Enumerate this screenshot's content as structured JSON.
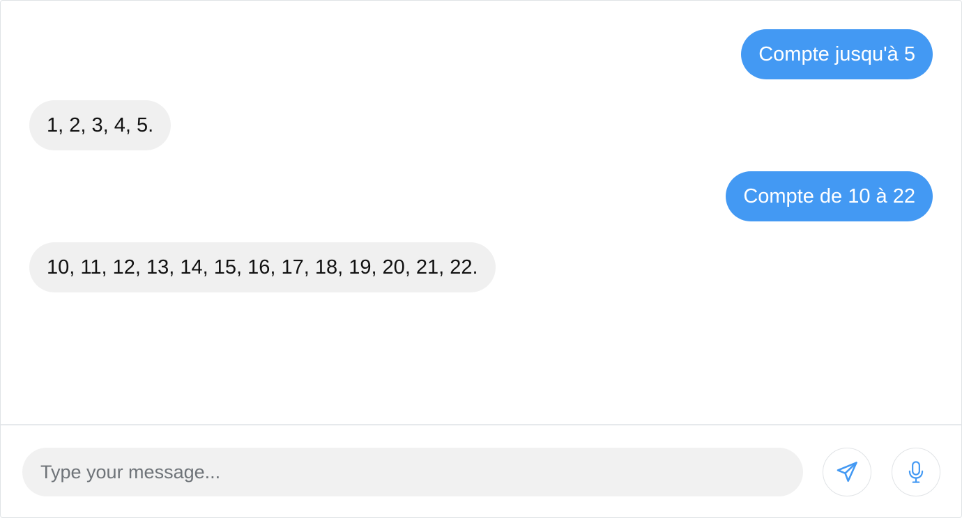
{
  "messages": [
    {
      "sender": "user",
      "text": "Compte jusqu'à 5"
    },
    {
      "sender": "bot",
      "text": "1, 2, 3, 4, 5."
    },
    {
      "sender": "user",
      "text": "Compte de 10 à 22"
    },
    {
      "sender": "bot",
      "text": "10, 11, 12, 13, 14, 15, 16, 17, 18, 19, 20, 21, 22."
    }
  ],
  "composer": {
    "placeholder": "Type your message...",
    "value": ""
  },
  "icons": {
    "send": "paper-plane-icon",
    "mic": "microphone-icon"
  },
  "colors": {
    "user_bubble": "#4399f3",
    "bot_bubble": "#f0f0f0",
    "icon_accent": "#4399f3"
  }
}
